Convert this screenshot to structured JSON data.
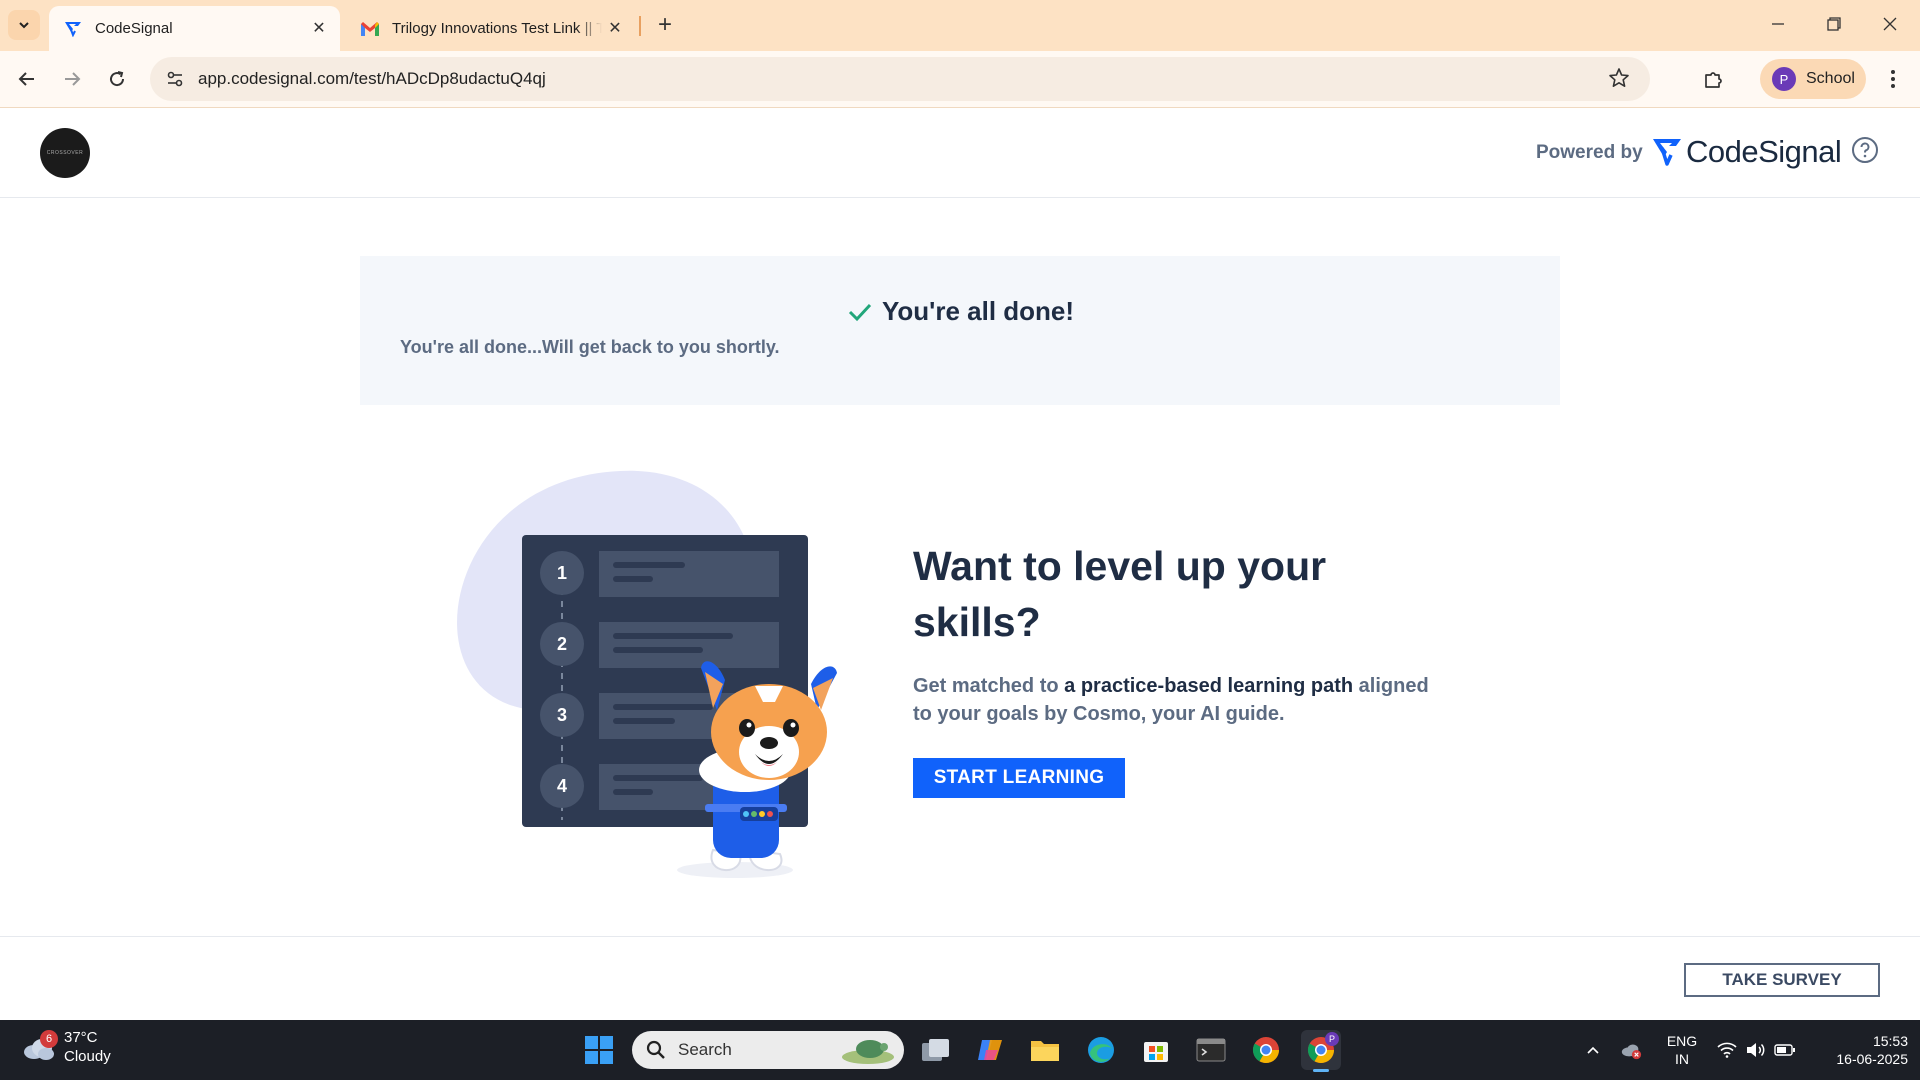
{
  "browser": {
    "tabs": [
      {
        "title": "CodeSignal",
        "active": true
      },
      {
        "title": "Trilogy Innovations Test Link || T",
        "active": false
      }
    ],
    "url": "app.codesignal.com/test/hADcDp8udactuQ4qj",
    "profile": {
      "initial": "P",
      "label": "School"
    }
  },
  "header": {
    "logo_text": "CROSSOVER",
    "powered_by": "Powered by",
    "brand": "CodeSignal"
  },
  "done": {
    "title": "You're all done!",
    "subtitle": "You're all done...Will get back to you shortly."
  },
  "promo": {
    "steps": [
      "1",
      "2",
      "3",
      "4"
    ],
    "title": "Want to level up your skills?",
    "desc_prefix": "Get matched to ",
    "desc_bold": "a practice-based learning path",
    "desc_suffix": " aligned to your goals by Cosmo, your AI guide.",
    "button": "START LEARNING"
  },
  "footer": {
    "survey_button": "TAKE SURVEY"
  },
  "taskbar": {
    "weather_badge": "6",
    "temperature": "37°C",
    "condition": "Cloudy",
    "search_placeholder": "Search",
    "lang_top": "ENG",
    "lang_bottom": "IN",
    "time": "15:53",
    "date": "16-06-2025",
    "chrome_profile_badge": "P"
  },
  "colors": {
    "accent": "#1062fb",
    "tabstrip": "#fde2c4",
    "check": "#21a67a",
    "heading": "#1f2d44",
    "muted": "#5c6b82"
  }
}
